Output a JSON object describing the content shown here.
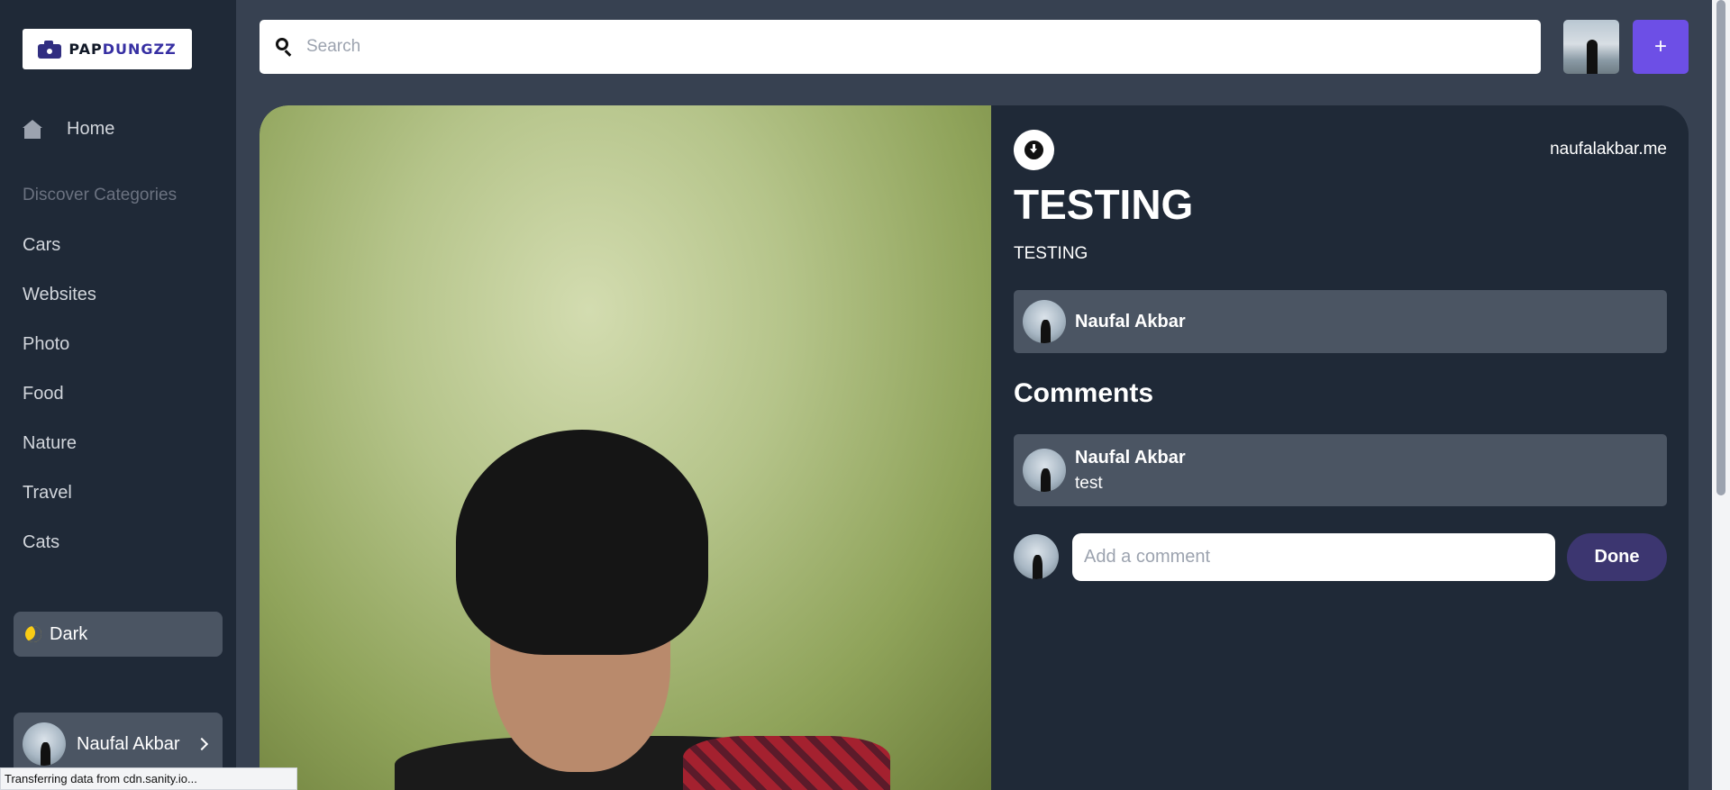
{
  "logo": {
    "text_main": "PAP",
    "text_accent": "DUNGZZ"
  },
  "sidebar": {
    "home_label": "Home",
    "discover_label": "Discover Categories",
    "categories": [
      "Cars",
      "Websites",
      "Photo",
      "Food",
      "Nature",
      "Travel",
      "Cats"
    ],
    "theme_toggle_label": "Dark",
    "user_name": "Naufal Akbar"
  },
  "search": {
    "placeholder": "Search"
  },
  "header": {
    "add_label": "+"
  },
  "pin": {
    "site": "naufalakbar.me",
    "title": "TESTING",
    "about": "TESTING",
    "author": "Naufal Akbar"
  },
  "comments": {
    "heading": "Comments",
    "items": [
      {
        "author": "Naufal Akbar",
        "text": "test"
      }
    ],
    "input_placeholder": "Add a comment",
    "submit_label": "Done"
  },
  "status_bar": {
    "text": "Transferring data from cdn.sanity.io..."
  },
  "colors": {
    "accent": "#6d4fe6",
    "sidebar_bg": "#1f2937",
    "page_bg": "#374151",
    "card_bg": "#4b5563"
  }
}
